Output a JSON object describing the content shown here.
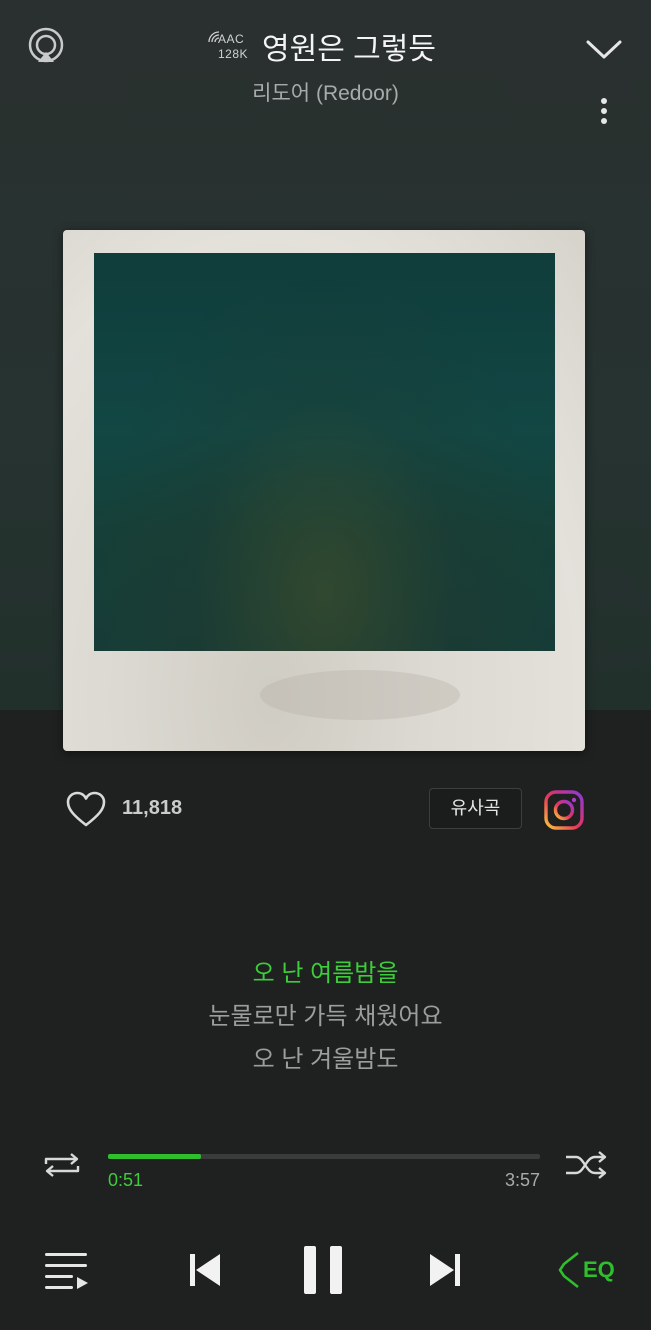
{
  "player": {
    "codec_format": "AAC",
    "codec_bitrate": "128K",
    "song_title": "영원은 그렇듯",
    "artist": "리도어 (Redoor)"
  },
  "actions": {
    "like_count": "11,818",
    "similar_songs_label": "유사곡"
  },
  "lyrics": {
    "current": "오 난 여름밤을",
    "next": [
      "눈물로만 가득 채웠어요",
      "오 난 겨울밤도"
    ]
  },
  "playback": {
    "elapsed": "0:51",
    "total": "3:57",
    "progress_fraction": 0.215,
    "state": "playing"
  },
  "controls": {
    "eq_label": "EQ"
  },
  "colors": {
    "accent": "#2fbf2c",
    "background": "#1f2020"
  },
  "icons": [
    "cast-icon",
    "chevron-down-icon",
    "more-vertical-icon",
    "heart-icon",
    "instagram-icon",
    "repeat-icon",
    "shuffle-icon",
    "playlist-icon",
    "previous-icon",
    "pause-icon",
    "next-icon",
    "equalizer-icon"
  ]
}
